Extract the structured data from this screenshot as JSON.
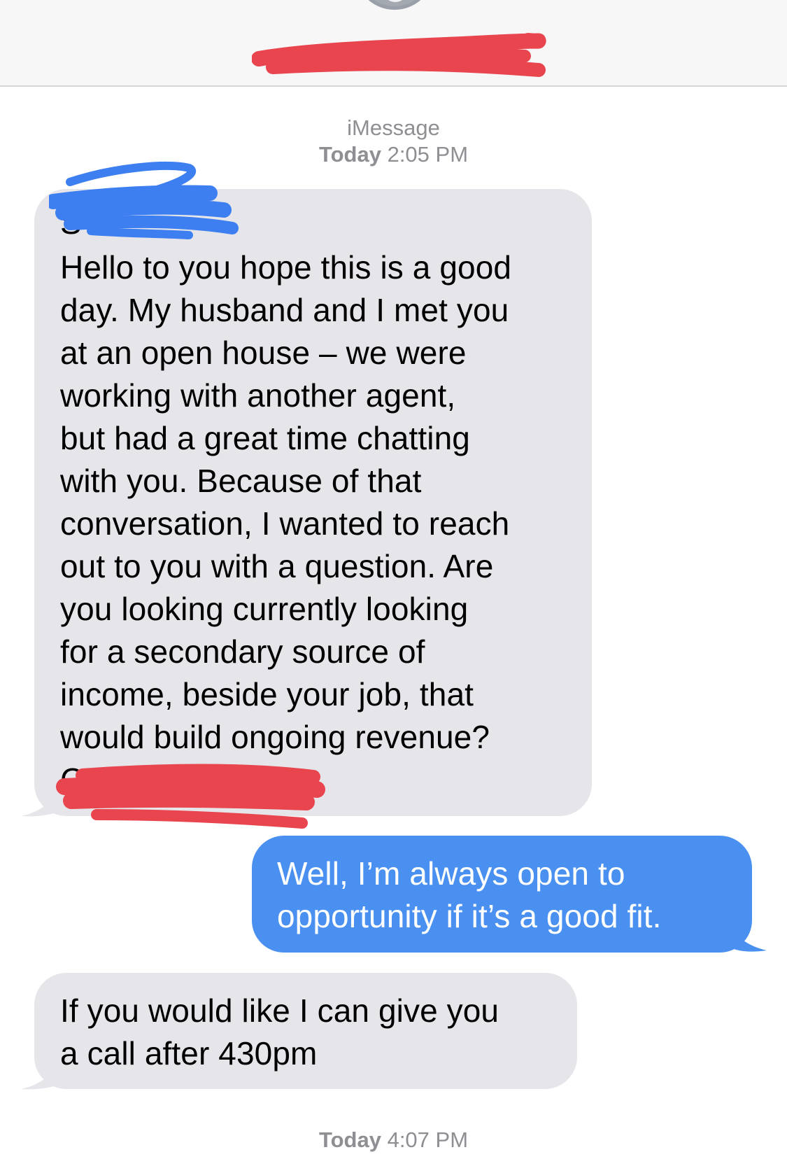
{
  "header": {
    "contact_name": "",
    "avatar_icon": "person-silhouette-icon"
  },
  "conversation": {
    "service_label": "iMessage",
    "timestamp_1": {
      "day": "Today",
      "time": "2:05 PM"
    },
    "timestamp_2": {
      "day": "Today",
      "time": "4:07 PM"
    },
    "messages": [
      {
        "direction": "incoming",
        "lines": [
          "S",
          "Hello to you hope this is a good",
          "day. My husband and I met you",
          "at an open house – we were",
          "working with another agent,",
          "but had a great time chatting",
          "with you. Because of that",
          "conversation, I wanted to reach",
          "out to you with a question. Are",
          "you looking currently looking",
          "for a secondary source of",
          "income, beside your job, that",
          "would build ongoing revenue?",
          "C"
        ]
      },
      {
        "direction": "outgoing",
        "lines": [
          "Well, I’m always open to",
          "opportunity if it’s a good fit."
        ]
      },
      {
        "direction": "incoming",
        "lines": [
          "If you would like I can give you",
          "a call after 430pm"
        ]
      }
    ]
  },
  "colors": {
    "incoming_bubble": "#e5e5ea",
    "outgoing_bubble": "#4a90f0",
    "redaction_red": "#e8454f",
    "redaction_blue": "#3d7ff0",
    "meta_gray": "#8e8e93"
  }
}
